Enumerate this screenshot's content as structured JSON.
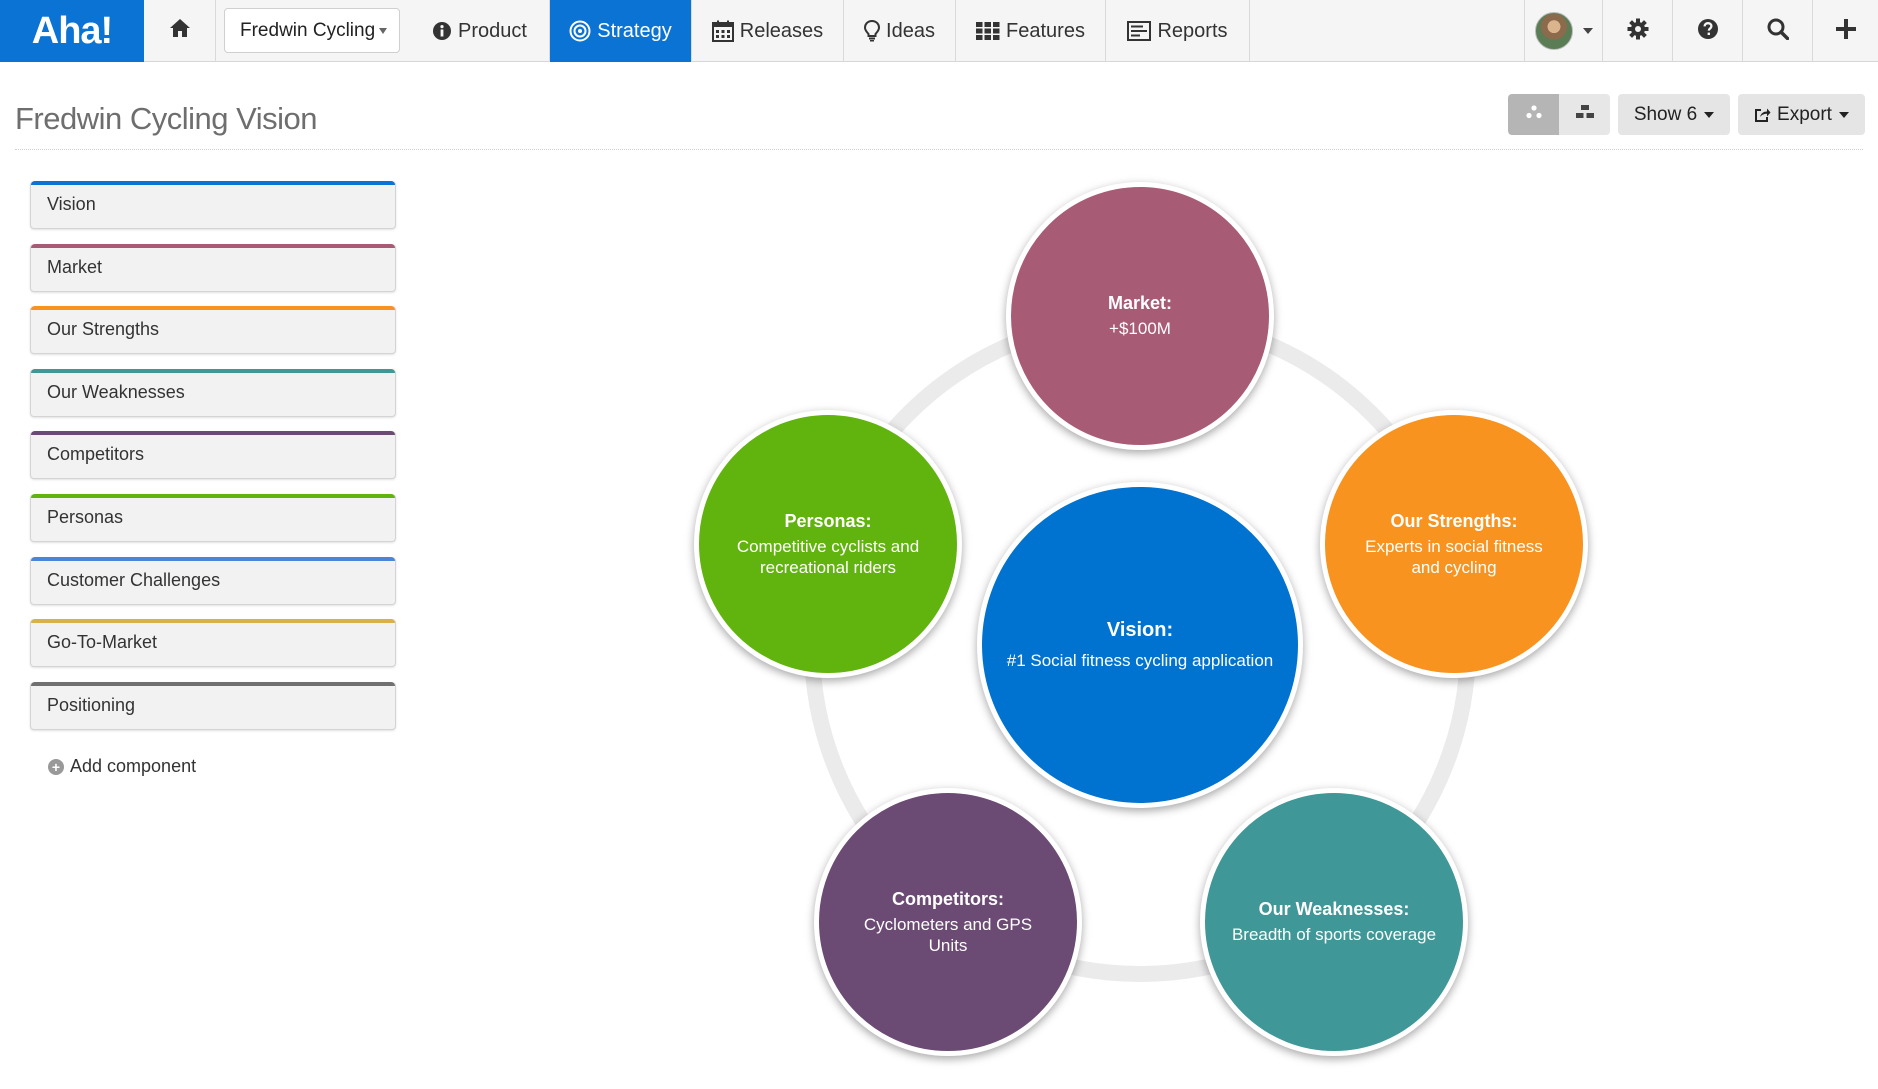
{
  "app": {
    "logo": "Aha!"
  },
  "nav": {
    "product_select": "Fredwin Cycling",
    "tabs": [
      {
        "label": "Product",
        "icon": "info-circle-icon"
      },
      {
        "label": "Strategy",
        "icon": "target-icon",
        "active": true
      },
      {
        "label": "Releases",
        "icon": "calendar-icon"
      },
      {
        "label": "Ideas",
        "icon": "lightbulb-icon"
      },
      {
        "label": "Features",
        "icon": "grid-icon"
      },
      {
        "label": "Reports",
        "icon": "report-list-icon"
      }
    ],
    "right_icons": [
      "avatar",
      "gear-icon",
      "question-circle-icon",
      "search-icon",
      "plus-icon"
    ]
  },
  "page": {
    "title": "Fredwin Cycling Vision",
    "show_button": "Show 6",
    "export_button": "Export"
  },
  "colors": {
    "brand": "#0a73d4",
    "vision": "#0072cf",
    "market": "#a85b74",
    "strengths": "#f7931e",
    "weaknesses": "#3f9797",
    "competitors": "#6b4a73",
    "personas": "#61b30e",
    "customer_challenges": "#4a86d8",
    "go_to_market": "#d8b14a",
    "positioning": "#707070"
  },
  "sidebar": {
    "components": [
      {
        "label": "Vision",
        "color": "#0a73d4"
      },
      {
        "label": "Market",
        "color": "#a85b74"
      },
      {
        "label": "Our Strengths",
        "color": "#f7931e"
      },
      {
        "label": "Our Weaknesses",
        "color": "#3f9797"
      },
      {
        "label": "Competitors",
        "color": "#6b4a73"
      },
      {
        "label": "Personas",
        "color": "#61b30e"
      },
      {
        "label": "Customer Challenges",
        "color": "#4a86d8"
      },
      {
        "label": "Go-To-Market",
        "color": "#d8b14a"
      },
      {
        "label": "Positioning",
        "color": "#707070"
      }
    ],
    "add_component": "Add component"
  },
  "diagram": {
    "center": {
      "title": "Vision:",
      "desc": "#1 Social fitness cycling application"
    },
    "market": {
      "title": "Market:",
      "desc": "+$100M"
    },
    "strengths": {
      "title": "Our Strengths:",
      "desc": "Experts in social fitness and cycling"
    },
    "weaknesses": {
      "title": "Our Weaknesses:",
      "desc": "Breadth of sports coverage"
    },
    "competitors": {
      "title": "Competitors:",
      "desc": "Cyclometers and GPS Units"
    },
    "personas": {
      "title": "Personas:",
      "desc": "Competitive cyclists and recreational riders"
    }
  }
}
